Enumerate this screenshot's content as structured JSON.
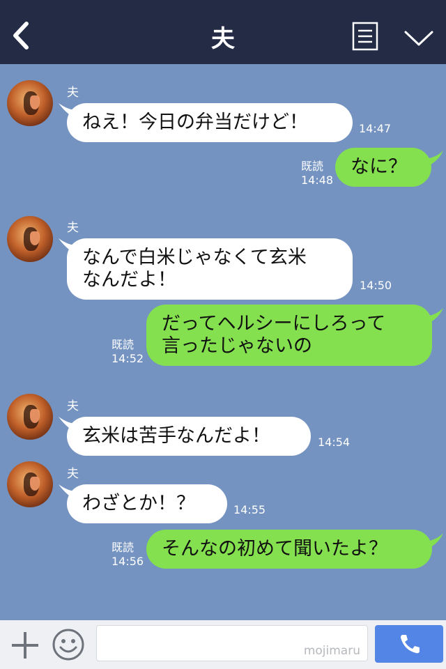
{
  "header": {
    "title": "夫",
    "back_icon": "chevron-left-icon",
    "notes_icon": "notes-icon",
    "menu_icon": "chevron-down-icon"
  },
  "messages": [
    {
      "side": "left",
      "sender": "夫",
      "text": "ねえ！今日の弁当だけど！",
      "time": "14:47"
    },
    {
      "side": "right",
      "read": "既読",
      "text": "なに？",
      "time": "14:48"
    },
    {
      "side": "left",
      "sender": "夫",
      "text": "なんで白米じゃなくて玄米\nなんだよ！",
      "time": "14:50"
    },
    {
      "side": "right",
      "read": "既読",
      "text": "だってヘルシーにしろって\n言ったじゃないの",
      "time": "14:52"
    },
    {
      "side": "left",
      "sender": "夫",
      "text": "玄米は苦手なんだよ！",
      "time": "14:54"
    },
    {
      "side": "left",
      "sender": "夫",
      "text": "わざとか！？",
      "time": "14:55"
    },
    {
      "side": "right",
      "read": "既読",
      "text": "そんなの初めて聞いたよ？",
      "time": "14:56"
    }
  ],
  "footer": {
    "plus_icon": "plus-icon",
    "emoji_icon": "smiley-icon",
    "input_value": "",
    "watermark": "mojimaru",
    "call_icon": "phone-icon"
  },
  "colors": {
    "header_bg": "#232b45",
    "chat_bg": "#7493c1",
    "my_bubble": "#84e04e",
    "their_bubble": "#ffffff",
    "call_button": "#5285e6"
  }
}
